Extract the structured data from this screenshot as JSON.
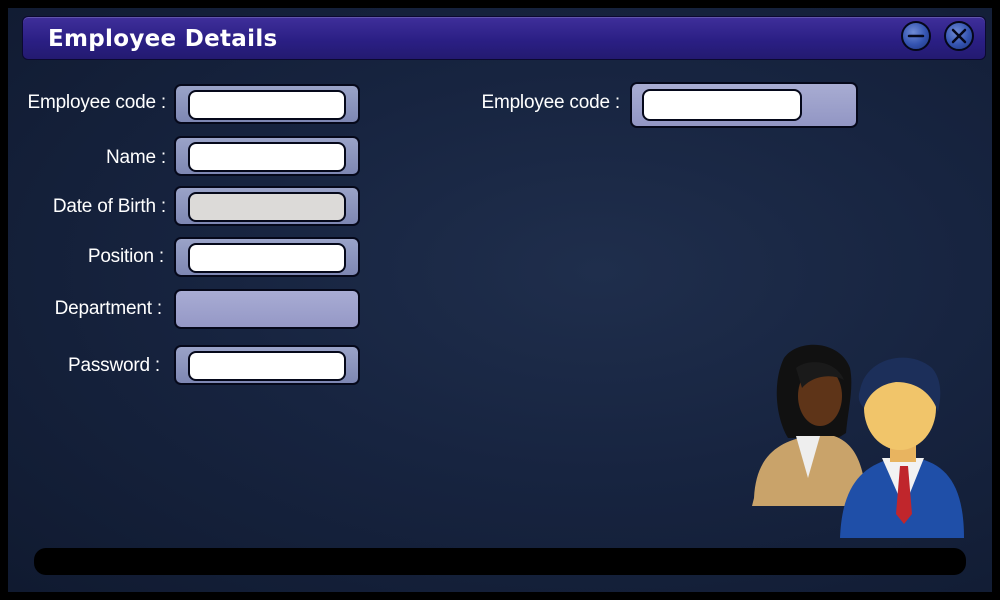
{
  "window": {
    "title": "Employee Details"
  },
  "form": {
    "left": [
      {
        "label": "Employee code :",
        "value": "",
        "placeholder": ""
      },
      {
        "label": "Name :",
        "value": "",
        "placeholder": ""
      },
      {
        "label": "Date of Birth :",
        "value": "",
        "placeholder": ""
      },
      {
        "label": "Position :",
        "value": "",
        "placeholder": ""
      },
      {
        "label": "Department :",
        "value": "",
        "placeholder": ""
      },
      {
        "label": "Password :",
        "value": "",
        "placeholder": ""
      }
    ],
    "right": [
      {
        "label": "Employee code :",
        "value": "",
        "placeholder": ""
      }
    ]
  },
  "icons": {
    "minimize": "minimize-icon",
    "close": "close-icon",
    "users": "users-icon"
  },
  "colors": {
    "titlebar": "#2b1f85",
    "background": "#172440",
    "field_frame": "#9aa3c8"
  }
}
